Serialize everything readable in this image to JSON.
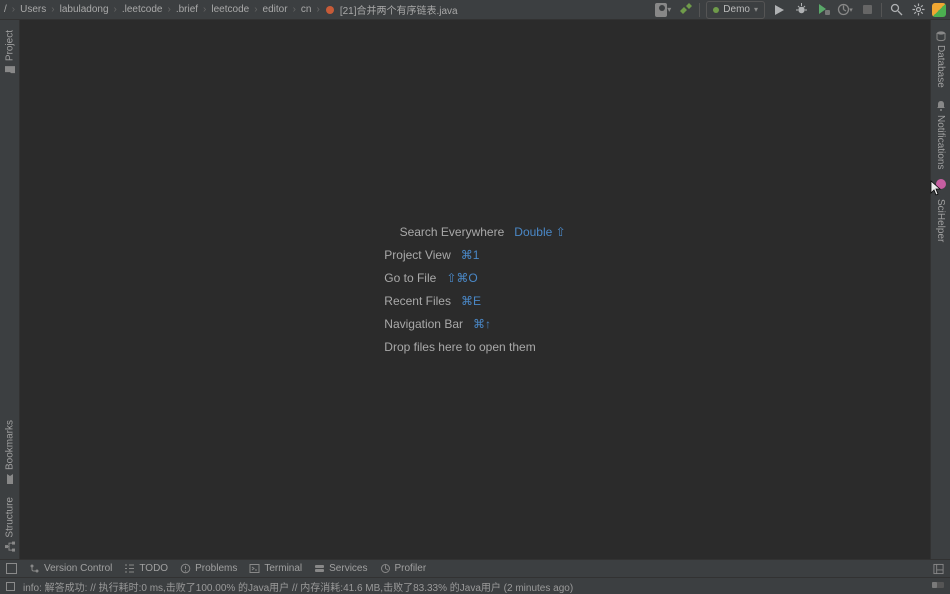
{
  "breadcrumb": {
    "items": [
      "/",
      "Users",
      "labuladong",
      ".leetcode",
      ".brief",
      "leetcode",
      "editor",
      "cn"
    ],
    "file": "[21]合并两个有序链表.java"
  },
  "run_config": {
    "label": "Demo"
  },
  "shortcuts": {
    "search_label": "Search Everywhere",
    "search_key": "Double ⇧",
    "project_label": "Project View",
    "project_key": "⌘1",
    "gotofile_label": "Go to File",
    "gotofile_key": "⇧⌘O",
    "recent_label": "Recent Files",
    "recent_key": "⌘E",
    "navbar_label": "Navigation Bar",
    "navbar_key": "⌘↑",
    "drop_label": "Drop files here to open them"
  },
  "left_tabs": {
    "project": "Project",
    "bookmarks": "Bookmarks",
    "structure": "Structure"
  },
  "right_tabs": {
    "database": "Database",
    "notifications": "Notifications",
    "scihelper": "SciHelper"
  },
  "bottom": {
    "version_control": "Version Control",
    "todo": "TODO",
    "problems": "Problems",
    "terminal": "Terminal",
    "services": "Services",
    "profiler": "Profiler"
  },
  "status": {
    "message": "info: 解答成功: // 执行耗时:0 ms,击败了100.00% 的Java用户 // 内存消耗:41.6 MB,击败了83.33% 的Java用户 (2 minutes ago)"
  }
}
